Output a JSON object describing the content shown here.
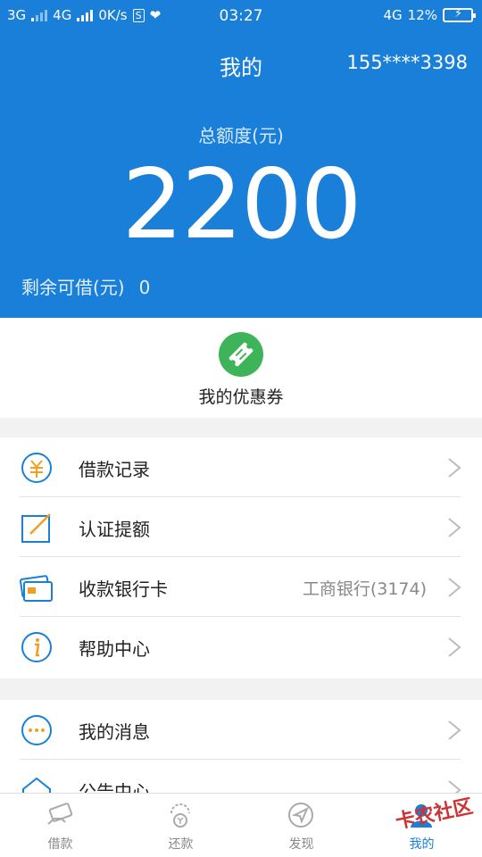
{
  "status": {
    "net1": "3G",
    "net2": "4G",
    "speed": "0K/s",
    "time": "03:27",
    "net3": "4G",
    "battery": "12%"
  },
  "header": {
    "title": "我的",
    "phone": "155****3398",
    "quota_label": "总额度(元)",
    "quota_value": "2200",
    "remain_label": "剩余可借(元)",
    "remain_value": "0"
  },
  "coupon": {
    "label": "我的优惠券"
  },
  "menu": [
    {
      "label": "借款记录",
      "icon": "yuan-icon"
    },
    {
      "label": "认证提额",
      "icon": "edit-icon"
    },
    {
      "label": "收款银行卡",
      "icon": "bank-card-icon",
      "extra": "工商银行(3174)"
    },
    {
      "label": "帮助中心",
      "icon": "info-icon"
    }
  ],
  "menu2": [
    {
      "label": "我的消息",
      "icon": "message-icon"
    },
    {
      "label": "公告中心",
      "icon": "notice-icon"
    }
  ],
  "tabs": [
    {
      "label": "借款",
      "icon": "loan-icon"
    },
    {
      "label": "还款",
      "icon": "repay-icon"
    },
    {
      "label": "发现",
      "icon": "discover-icon"
    },
    {
      "label": "我的",
      "icon": "profile-icon",
      "active": true
    }
  ],
  "colors": {
    "brand": "#1a7fd8",
    "coupon": "#3db35a",
    "icon_orange": "#f0a020"
  },
  "watermark": "卡农社区"
}
